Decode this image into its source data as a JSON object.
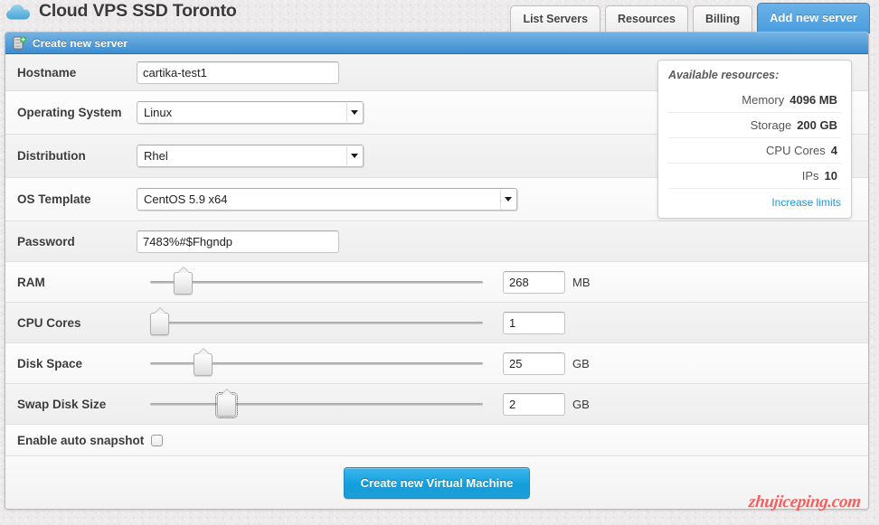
{
  "header": {
    "brand_title": "Cloud VPS SSD Toronto",
    "logo_icon": "cloud-icon",
    "tabs": [
      {
        "label": "List Servers",
        "active": false
      },
      {
        "label": "Resources",
        "active": false
      },
      {
        "label": "Billing",
        "active": false
      },
      {
        "label": "Add new server",
        "active": true
      }
    ]
  },
  "panel": {
    "title": "Create new server",
    "icon": "server-add-icon"
  },
  "form": {
    "hostname": {
      "label": "Hostname",
      "value": "cartika-test1"
    },
    "operating_system": {
      "label": "Operating System",
      "value": "Linux"
    },
    "distribution": {
      "label": "Distribution",
      "value": "Rhel"
    },
    "os_template": {
      "label": "OS Template",
      "value": "CentOS 5.9 x64"
    },
    "password": {
      "label": "Password",
      "value": "7483%#$Fhgndp"
    },
    "ram": {
      "label": "RAM",
      "value": "268",
      "unit": "MB",
      "slider_pct": 7
    },
    "cpu_cores": {
      "label": "CPU Cores",
      "value": "1",
      "unit": "",
      "slider_pct": 0
    },
    "disk_space": {
      "label": "Disk Space",
      "value": "25",
      "unit": "GB",
      "slider_pct": 13
    },
    "swap_disk_size": {
      "label": "Swap Disk Size",
      "value": "2",
      "unit": "GB",
      "slider_pct": 20
    },
    "auto_snapshot": {
      "label": "Enable auto snapshot",
      "checked": false
    },
    "submit_label": "Create new Virtual Machine"
  },
  "resources": {
    "title": "Available resources:",
    "items": [
      {
        "label": "Memory",
        "value": "4096 MB"
      },
      {
        "label": "Storage",
        "value": "200 GB"
      },
      {
        "label": "CPU Cores",
        "value": "4"
      },
      {
        "label": "IPs",
        "value": "10"
      }
    ],
    "link_label": "Increase limits"
  },
  "watermark": {
    "text": "zhujiceping.com"
  },
  "colors": {
    "accent_blue": "#4a9cdd",
    "panel_header_blue": "#3d8dd0",
    "primary_button": "#17a3e0",
    "link_blue": "#2196dd",
    "watermark_red": "#f0625f"
  }
}
